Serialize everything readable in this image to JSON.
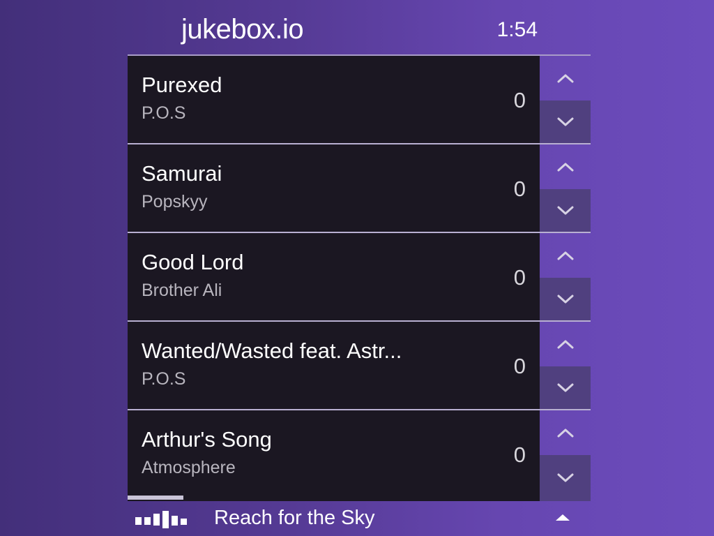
{
  "header": {
    "app_title": "jukebox.io",
    "clock": "1:54"
  },
  "queue": [
    {
      "title": "Purexed",
      "artist": "P.O.S",
      "votes": "0"
    },
    {
      "title": "Samurai",
      "artist": "Popskyy",
      "votes": "0"
    },
    {
      "title": "Good Lord",
      "artist": "Brother Ali",
      "votes": "0"
    },
    {
      "title": "Wanted/Wasted feat. Astr...",
      "artist": "P.O.S",
      "votes": "0"
    },
    {
      "title": "Arthur's Song",
      "artist": "Atmosphere",
      "votes": "0"
    }
  ],
  "now_playing": {
    "title": "Reach for the Sky",
    "progress": 0.12,
    "icon": "equalizer-icon",
    "expand_icon": "caret-up-icon"
  },
  "icons": {
    "vote_up": "chevron-up-icon",
    "vote_down": "chevron-down-icon"
  },
  "colors": {
    "background_start": "#432f7a",
    "background_end": "#6c4cbd",
    "card": "#1b1722",
    "downvote_bg": "#50407f"
  }
}
